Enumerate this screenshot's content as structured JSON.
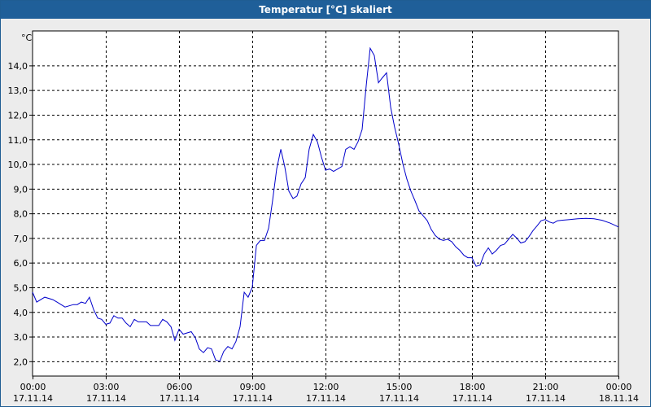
{
  "window": {
    "title": "Temperatur [°C] skaliert"
  },
  "colors": {
    "titlebar": "#1f5f99",
    "background": "#ececec",
    "plot_background": "#ffffff",
    "series_line": "#0000cc",
    "grid": "#000000"
  },
  "chart_data": {
    "type": "line",
    "title": "Temperatur [°C] skaliert",
    "ylabel": "°C",
    "xlabel": "",
    "ylim": [
      1.4,
      15.4
    ],
    "y_ticks": [
      2.0,
      3.0,
      4.0,
      5.0,
      6.0,
      7.0,
      8.0,
      9.0,
      10.0,
      11.0,
      12.0,
      13.0,
      14.0
    ],
    "y_tick_labels": [
      "2,0",
      "3,0",
      "4,0",
      "5,0",
      "6,0",
      "7,0",
      "8,0",
      "9,0",
      "10,0",
      "11,0",
      "12,0",
      "13,0",
      "14,0"
    ],
    "x_range_hours": [
      0,
      24
    ],
    "x_ticks": [
      0,
      3,
      6,
      9,
      12,
      15,
      18,
      21,
      24
    ],
    "x_tick_labels": [
      [
        "00:00",
        "17.11.14"
      ],
      [
        "03:00",
        "17.11.14"
      ],
      [
        "06:00",
        "17.11.14"
      ],
      [
        "09:00",
        "17.11.14"
      ],
      [
        "12:00",
        "17.11.14"
      ],
      [
        "15:00",
        "17.11.14"
      ],
      [
        "18:00",
        "17.11.14"
      ],
      [
        "21:00",
        "17.11.14"
      ],
      [
        "00:00",
        "18.11.14"
      ]
    ],
    "grid": true,
    "legend": "none",
    "series": [
      {
        "points": [
          [
            0.0,
            4.8
          ],
          [
            0.17,
            4.4
          ],
          [
            0.5,
            4.6
          ],
          [
            0.83,
            4.5
          ],
          [
            1.0,
            4.4
          ],
          [
            1.33,
            4.2
          ],
          [
            1.67,
            4.3
          ],
          [
            1.83,
            4.3
          ],
          [
            2.0,
            4.4
          ],
          [
            2.17,
            4.35
          ],
          [
            2.33,
            4.6
          ],
          [
            2.5,
            4.1
          ],
          [
            2.67,
            3.75
          ],
          [
            2.83,
            3.7
          ],
          [
            3.0,
            3.5
          ],
          [
            3.17,
            3.55
          ],
          [
            3.33,
            3.85
          ],
          [
            3.5,
            3.75
          ],
          [
            3.67,
            3.75
          ],
          [
            3.83,
            3.55
          ],
          [
            4.0,
            3.4
          ],
          [
            4.17,
            3.7
          ],
          [
            4.33,
            3.6
          ],
          [
            4.67,
            3.6
          ],
          [
            4.83,
            3.45
          ],
          [
            5.17,
            3.45
          ],
          [
            5.33,
            3.7
          ],
          [
            5.5,
            3.6
          ],
          [
            5.67,
            3.4
          ],
          [
            5.83,
            2.85
          ],
          [
            6.0,
            3.3
          ],
          [
            6.17,
            3.1
          ],
          [
            6.33,
            3.15
          ],
          [
            6.5,
            3.2
          ],
          [
            6.67,
            2.95
          ],
          [
            6.83,
            2.5
          ],
          [
            7.0,
            2.35
          ],
          [
            7.17,
            2.55
          ],
          [
            7.33,
            2.5
          ],
          [
            7.5,
            2.05
          ],
          [
            7.67,
            2.0
          ],
          [
            7.83,
            2.4
          ],
          [
            8.0,
            2.6
          ],
          [
            8.17,
            2.5
          ],
          [
            8.33,
            2.8
          ],
          [
            8.5,
            3.4
          ],
          [
            8.67,
            4.8
          ],
          [
            8.83,
            4.6
          ],
          [
            9.0,
            5.0
          ],
          [
            9.17,
            6.7
          ],
          [
            9.33,
            6.9
          ],
          [
            9.5,
            6.9
          ],
          [
            9.67,
            7.4
          ],
          [
            9.83,
            8.5
          ],
          [
            10.0,
            9.8
          ],
          [
            10.17,
            10.6
          ],
          [
            10.33,
            9.9
          ],
          [
            10.5,
            8.9
          ],
          [
            10.67,
            8.6
          ],
          [
            10.83,
            8.7
          ],
          [
            11.0,
            9.2
          ],
          [
            11.17,
            9.45
          ],
          [
            11.33,
            10.6
          ],
          [
            11.5,
            11.2
          ],
          [
            11.67,
            10.9
          ],
          [
            11.83,
            10.3
          ],
          [
            12.0,
            9.75
          ],
          [
            12.17,
            9.8
          ],
          [
            12.33,
            9.7
          ],
          [
            12.5,
            9.8
          ],
          [
            12.67,
            9.9
          ],
          [
            12.83,
            10.6
          ],
          [
            13.0,
            10.7
          ],
          [
            13.17,
            10.6
          ],
          [
            13.33,
            10.9
          ],
          [
            13.5,
            11.4
          ],
          [
            13.67,
            13.2
          ],
          [
            13.83,
            14.7
          ],
          [
            14.0,
            14.4
          ],
          [
            14.17,
            13.3
          ],
          [
            14.33,
            13.5
          ],
          [
            14.5,
            13.7
          ],
          [
            14.67,
            12.3
          ],
          [
            14.83,
            11.5
          ],
          [
            15.0,
            10.8
          ],
          [
            15.17,
            10.0
          ],
          [
            15.33,
            9.4
          ],
          [
            15.5,
            8.9
          ],
          [
            15.67,
            8.5
          ],
          [
            15.83,
            8.1
          ],
          [
            16.0,
            7.9
          ],
          [
            16.17,
            7.7
          ],
          [
            16.33,
            7.35
          ],
          [
            16.5,
            7.1
          ],
          [
            16.67,
            6.95
          ],
          [
            16.83,
            6.9
          ],
          [
            17.0,
            6.95
          ],
          [
            17.17,
            6.85
          ],
          [
            17.33,
            6.65
          ],
          [
            17.5,
            6.5
          ],
          [
            17.67,
            6.3
          ],
          [
            17.83,
            6.2
          ],
          [
            18.0,
            6.2
          ],
          [
            18.17,
            5.85
          ],
          [
            18.33,
            5.9
          ],
          [
            18.5,
            6.35
          ],
          [
            18.67,
            6.6
          ],
          [
            18.83,
            6.35
          ],
          [
            19.0,
            6.5
          ],
          [
            19.17,
            6.7
          ],
          [
            19.33,
            6.75
          ],
          [
            19.5,
            6.95
          ],
          [
            19.67,
            7.15
          ],
          [
            19.83,
            7.0
          ],
          [
            20.0,
            6.8
          ],
          [
            20.17,
            6.85
          ],
          [
            20.33,
            7.05
          ],
          [
            20.5,
            7.3
          ],
          [
            20.67,
            7.5
          ],
          [
            20.83,
            7.7
          ],
          [
            21.0,
            7.75
          ],
          [
            21.17,
            7.65
          ],
          [
            21.33,
            7.6
          ],
          [
            21.5,
            7.7
          ],
          [
            21.67,
            7.72
          ],
          [
            22.0,
            7.75
          ],
          [
            22.33,
            7.78
          ],
          [
            22.67,
            7.8
          ],
          [
            23.0,
            7.78
          ],
          [
            23.33,
            7.72
          ],
          [
            23.67,
            7.6
          ],
          [
            24.0,
            7.45
          ]
        ]
      }
    ]
  }
}
